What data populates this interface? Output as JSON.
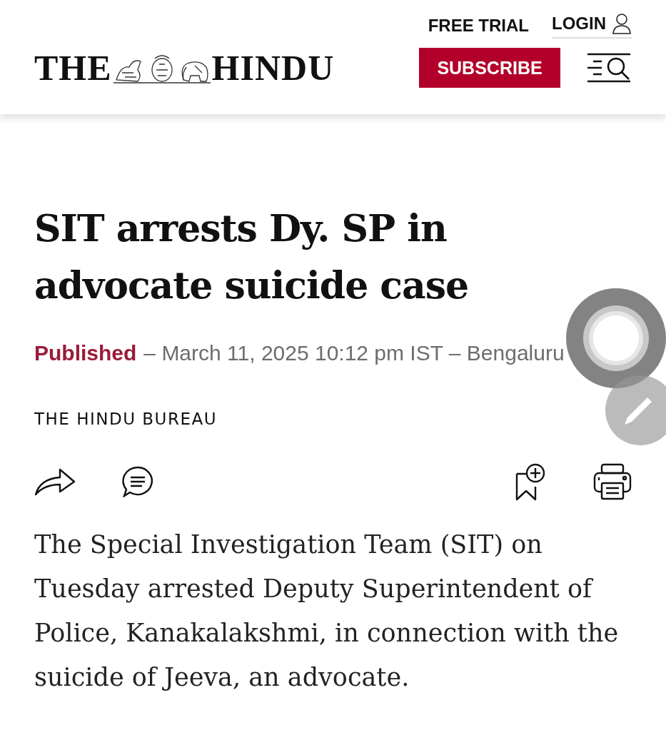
{
  "header": {
    "links": [
      {
        "label": "FREE TRIAL",
        "kind": "plain"
      },
      {
        "label": "LOGIN",
        "kind": "account"
      }
    ],
    "logo": {
      "left": "THE",
      "right": "HINDU"
    },
    "subscribe": "SUBSCRIBE"
  },
  "article": {
    "headline": "SIT arrests Dy. SP in advocate suicide case",
    "published": {
      "label": "Published",
      "detail": "– March 11, 2025 10:12 pm IST – Bengaluru"
    },
    "byline": "THE HINDU BUREAU",
    "body": "The Special Investigation Team (SIT) on Tuesday arrested Deputy Superintendent of Police, Kanakalakshmi, in connection with the suicide of Jeeva, an advocate."
  }
}
